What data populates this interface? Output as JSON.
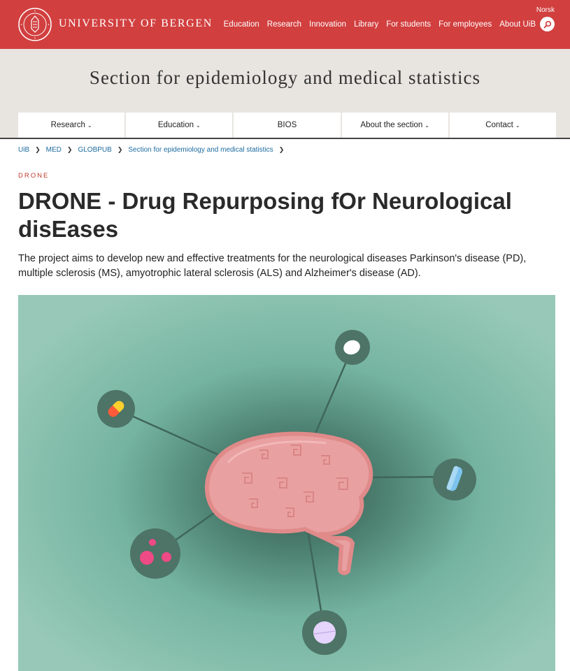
{
  "header": {
    "university_name": "UNIVERSITY OF BERGEN",
    "language_link": "Norsk",
    "nav": [
      "Education",
      "Research",
      "Innovation",
      "Library",
      "For students",
      "For employees",
      "About UiB"
    ],
    "search_icon": "search-icon",
    "brand_color": "#d23f3f"
  },
  "section": {
    "title": "Section for epidemiology and medical statistics",
    "menu": [
      {
        "label": "Research",
        "dropdown": true
      },
      {
        "label": "Education",
        "dropdown": true
      },
      {
        "label": "BIOS",
        "dropdown": false
      },
      {
        "label": "About the section",
        "dropdown": true
      },
      {
        "label": "Contact",
        "dropdown": true
      }
    ]
  },
  "breadcrumb": [
    "UiB",
    "MED",
    "GLOBPUB",
    "Section for epidemiology and medical statistics"
  ],
  "article": {
    "kicker": "DRONE",
    "title": "DRONE - Drug Repurposing fOr Neurological disEases",
    "lead": "The project aims to develop new and effective treatments for the neurological diseases Parkinson's disease (PD), multiple sclerosis (MS), amyotrophic lateral sclerosis (ALS) and Alzheimer's disease (AD)."
  },
  "hero_image": {
    "depicts": "brain-with-medicine-network-illustration",
    "colors": {
      "background": "#7bb8a5",
      "brain": "#eea0a0",
      "node": "#4d7466"
    }
  }
}
